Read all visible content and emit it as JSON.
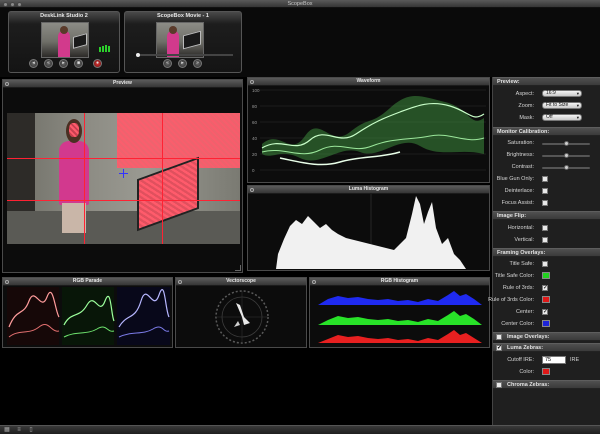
{
  "window": {
    "title": "ScopeBox"
  },
  "sources": [
    {
      "name": "DeskLink Studio 2"
    },
    {
      "name": "ScopeBox Movie - 1"
    }
  ],
  "panels": {
    "preview": "Preview",
    "waveform": "Waveform",
    "luma_histogram": "Luma Histogram",
    "rgb_parade": "RGB Parade",
    "vectorscope": "Vectorscope",
    "rgb_histogram": "RGB Histogram"
  },
  "waveform_scale": [
    "100",
    "80",
    "60",
    "40",
    "20",
    "0"
  ],
  "sidebar": {
    "preview_section": "Preview:",
    "aspect_label": "Aspect:",
    "aspect_value": "16:9",
    "zoom_label": "Zoom:",
    "zoom_value": "Fit to Size",
    "mask_label": "Mask:",
    "mask_value": "Off",
    "monitor_section": "Monitor Calibration:",
    "saturation_label": "Saturation:",
    "saturation_level": 0.5,
    "brightness_label": "Brightness:",
    "brightness_level": 0.5,
    "contrast_label": "Contrast:",
    "contrast_level": 0.5,
    "blue_gun_label": "Blue Gun Only:",
    "deinterlace_label": "Deinterlace:",
    "focus_assist_label": "Focus Assist:",
    "flip_section": "Image Flip:",
    "horizontal_label": "Horizontal:",
    "vertical_label": "Vertical:",
    "framing_section": "Framing Overlays:",
    "title_safe_label": "Title Safe:",
    "title_safe_color_label": "Title Safe Color:",
    "rule_thirds_label": "Rule of 3rds:",
    "rule_thirds_color_label": "Rule of 3rds Color:",
    "center_label": "Center:",
    "center_color_label": "Center Color:",
    "image_overlays_section": "Image Overlays:",
    "luma_zebras_section": "Luma Zebras:",
    "cutoff_label": "Cutoff IRE:",
    "cutoff_value": "75",
    "cutoff_unit": "IRE",
    "zebra_color_label": "Color:",
    "chroma_zebras_section": "Chroma Zebras:",
    "check_mark": "✓"
  },
  "colors": {
    "title_safe": "#22d11f",
    "rule_thirds": "#e01818",
    "center": "#1d24d8",
    "zebra": "#e01818"
  }
}
